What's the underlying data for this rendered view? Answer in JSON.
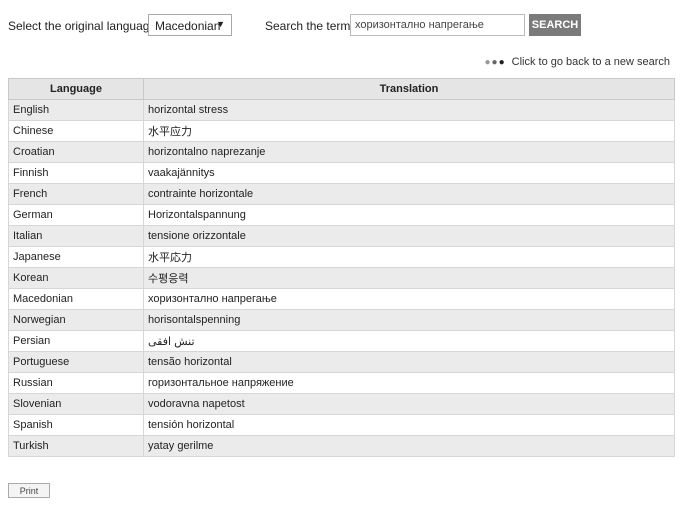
{
  "topbar": {
    "language_label": "Select the original language:",
    "language_value": "Macedonian",
    "search_label": "Search the term:",
    "search_value": "хоризонтално напрегање",
    "search_button": "SEARCH"
  },
  "back_link": {
    "dots": "●●●",
    "label": "Click to go back to a new search"
  },
  "table": {
    "headers": [
      "Language",
      "Translation"
    ],
    "rows": [
      {
        "language": "English",
        "translation": "horizontal stress"
      },
      {
        "language": "Chinese",
        "translation": "水平应力"
      },
      {
        "language": "Croatian",
        "translation": "horizontalno naprezanje"
      },
      {
        "language": "Finnish",
        "translation": "vaakajännitys"
      },
      {
        "language": "French",
        "translation": "contrainte horizontale"
      },
      {
        "language": "German",
        "translation": "Horizontalspannung"
      },
      {
        "language": "Italian",
        "translation": "tensione orizzontale"
      },
      {
        "language": "Japanese",
        "translation": "水平応力"
      },
      {
        "language": "Korean",
        "translation": "수평응력"
      },
      {
        "language": "Macedonian",
        "translation": "хоризонтално напрегање"
      },
      {
        "language": "Norwegian",
        "translation": "horisontalspenning"
      },
      {
        "language": "Persian",
        "translation": "تنش افقی"
      },
      {
        "language": "Portuguese",
        "translation": "tensão horizontal"
      },
      {
        "language": "Russian",
        "translation": "горизонтальное напряжение"
      },
      {
        "language": "Slovenian",
        "translation": "vodoravna napetost"
      },
      {
        "language": "Spanish",
        "translation": "tensión horizontal"
      },
      {
        "language": "Turkish",
        "translation": "yatay gerilme"
      }
    ]
  },
  "print_button": "Print"
}
